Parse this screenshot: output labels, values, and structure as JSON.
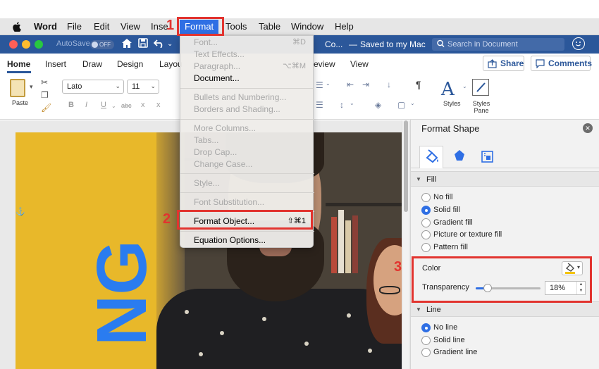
{
  "menubar": {
    "apple_icon": "apple-logo-icon",
    "items": [
      "Word",
      "File",
      "Edit",
      "View",
      "Inse",
      "Format",
      "Tools",
      "Table",
      "Window",
      "Help"
    ]
  },
  "titlebar": {
    "autosave_label": "AutoSave",
    "autosave_state": "OFF",
    "doc_title": "Co...",
    "separator": "—",
    "saved_status": "Saved to my Mac",
    "search_placeholder": "Search in Document"
  },
  "ribbon_tabs": {
    "items": [
      "Home",
      "Insert",
      "Draw",
      "Design",
      "Layou",
      "eview",
      "View"
    ],
    "active": "Home",
    "share_label": "Share",
    "comments_label": "Comments"
  },
  "ribbon": {
    "paste_label": "Paste",
    "font_name": "Lato",
    "font_size": "11",
    "format_buttons": [
      "B",
      "I",
      "U",
      "abc",
      "x",
      "x"
    ],
    "styles_label": "Styles",
    "styles_pane_label": "Styles Pane",
    "pilcrow": "¶"
  },
  "format_menu": {
    "group1": [
      {
        "label": "Font...",
        "shortcut": "⌘D",
        "enabled": false
      },
      {
        "label": "Text Effects...",
        "shortcut": "",
        "enabled": false
      },
      {
        "label": "Paragraph...",
        "shortcut": "⌥⌘M",
        "enabled": false
      },
      {
        "label": "Document...",
        "shortcut": "",
        "enabled": true
      }
    ],
    "group2": [
      {
        "label": "Bullets and Numbering...",
        "enabled": false
      },
      {
        "label": "Borders and Shading...",
        "enabled": false
      }
    ],
    "group3": [
      {
        "label": "More Columns...",
        "enabled": false
      },
      {
        "label": "Tabs...",
        "enabled": false
      },
      {
        "label": "Drop Cap...",
        "enabled": false
      },
      {
        "label": "Change Case...",
        "enabled": false
      }
    ],
    "group4": [
      {
        "label": "Style...",
        "enabled": false
      }
    ],
    "group5": [
      {
        "label": "Font Substitution...",
        "enabled": false
      }
    ],
    "group6": [
      {
        "label": "Format Object...",
        "shortcut": "⇧⌘1",
        "enabled": true
      }
    ],
    "group7": [
      {
        "label": "Equation Options...",
        "enabled": true
      }
    ]
  },
  "document": {
    "big_text": "NG"
  },
  "format_shape_pane": {
    "title": "Format Shape",
    "close_icon": "close-icon",
    "tabs": [
      "fill-line-icon",
      "effects-icon",
      "layout-properties-icon"
    ],
    "fill_section": {
      "heading": "Fill",
      "options": [
        {
          "label": "No fill",
          "selected": false
        },
        {
          "label": "Solid fill",
          "selected": true
        },
        {
          "label": "Gradient fill",
          "selected": false
        },
        {
          "label": "Picture or texture fill",
          "selected": false
        },
        {
          "label": "Pattern fill",
          "selected": false
        }
      ],
      "color_label": "Color",
      "color_value": "#f4c400",
      "transparency_label": "Transparency",
      "transparency_value": "18%",
      "transparency_fraction": 0.18
    },
    "line_section": {
      "heading": "Line",
      "options": [
        {
          "label": "No line",
          "selected": true
        },
        {
          "label": "Solid line",
          "selected": false
        },
        {
          "label": "Gradient line",
          "selected": false
        }
      ]
    }
  },
  "annotations": {
    "step1": "1",
    "step2": "2",
    "step3": "3"
  },
  "colors": {
    "accent_blue": "#2b579a",
    "highlight_blue": "#2f6fe4",
    "annotation_red": "#e2342f",
    "photo_yellow": "#e8b82a"
  }
}
